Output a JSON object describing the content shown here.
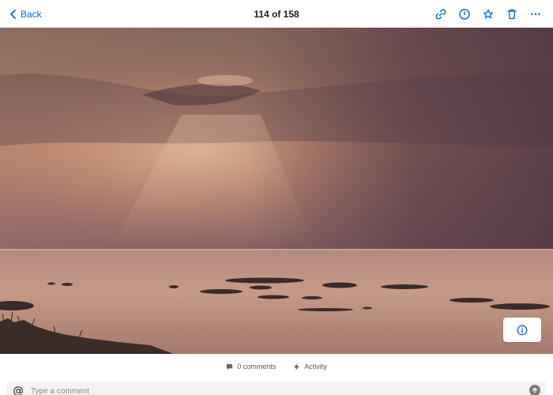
{
  "header": {
    "back_label": "Back",
    "counter": "114 of 158",
    "actions": [
      {
        "icon": "link-icon",
        "label": "Copy link"
      },
      {
        "icon": "clock-icon",
        "label": "History"
      },
      {
        "icon": "star-icon",
        "label": "Favorite"
      },
      {
        "icon": "trash-icon",
        "label": "Delete"
      },
      {
        "icon": "more-icon",
        "label": "More"
      }
    ]
  },
  "photo": {
    "subject": "sunset over sea with rocks",
    "info_button_icon": "info-icon"
  },
  "meta": {
    "comments_label": "0 comments",
    "activity_label": "Activity"
  },
  "comment": {
    "placeholder": "Type a comment"
  },
  "colors": {
    "accent": "#0b6bc9",
    "sky_top": "#8a6a5a",
    "sky_glow": "#e9b78c",
    "storm": "#5a3e47",
    "sea": "#b7897a"
  }
}
